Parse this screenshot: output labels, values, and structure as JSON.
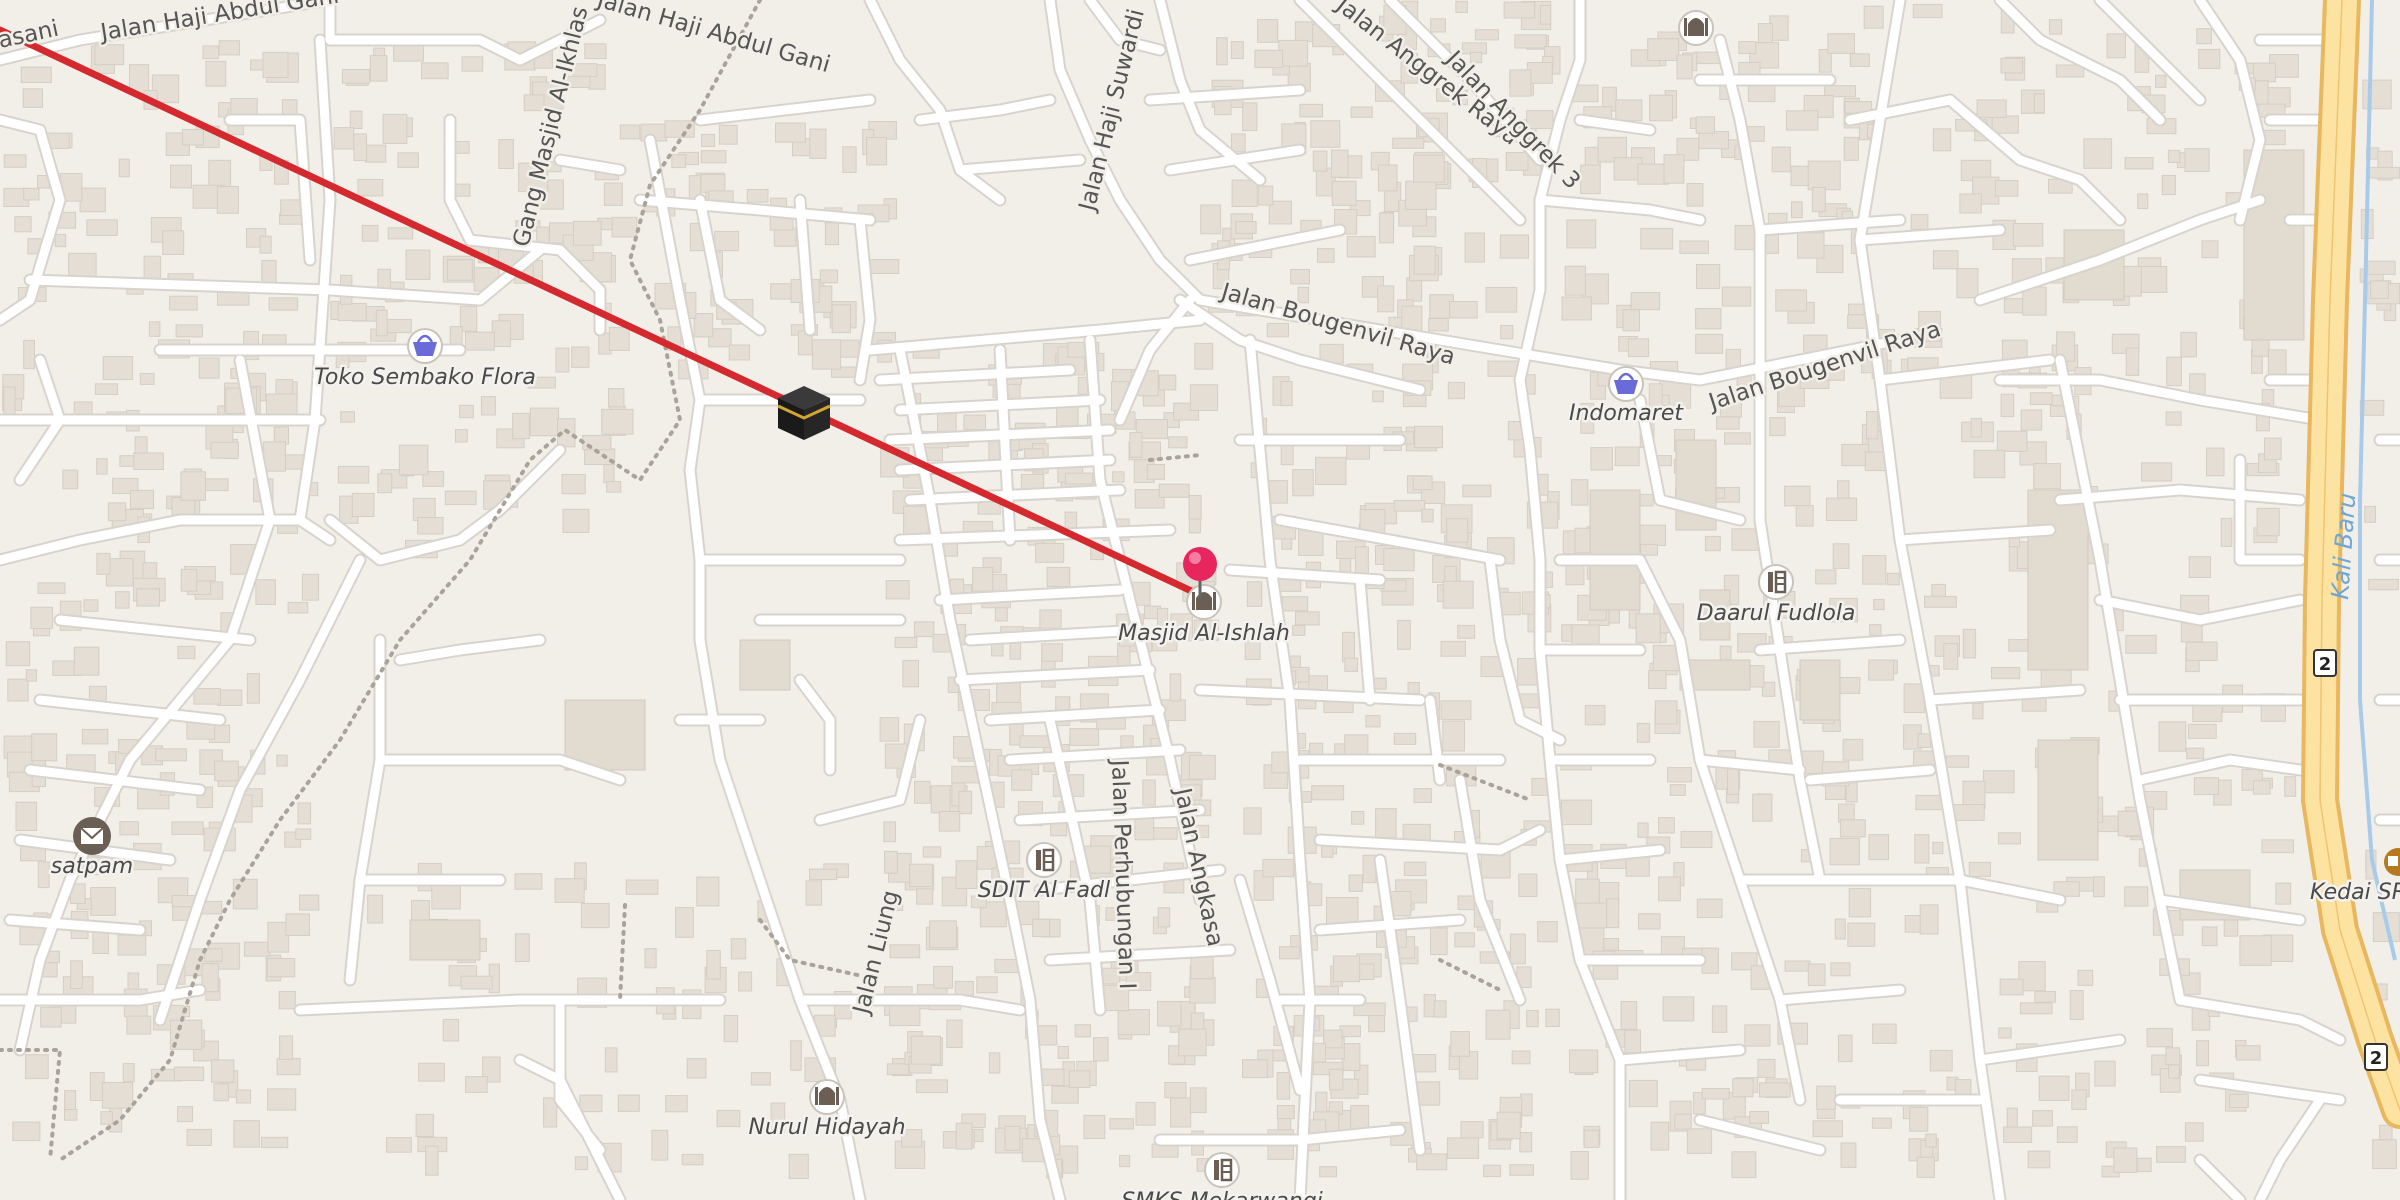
{
  "map": {
    "colors": {
      "background": "#f2efe9",
      "road": "#ffffff",
      "road_casing": "#d6d2cb",
      "building": "#e4ded4",
      "building_edge": "#d5cec3",
      "primary_road": "#fde3a1",
      "primary_casing": "#e8b75e",
      "qibla_line": "#d42a2f",
      "pin": "#e8265e",
      "water": "#a8cbea"
    },
    "streets": {
      "jalan_haji_abdul_gani_1": "Jalan Haji Abdul Gani",
      "jalan_haji_abdul_gani_2": "Jalan Haji Abdul Gani",
      "jalan_haji_abdul_gani_partial": "asani",
      "gang_masjid_al_ikhlas": "Gang Masjid Al-Ikhlas",
      "jalan_haji_suwardi": "Jalan Haji Suwardi",
      "jalan_anggrek_raya": "Jalan Anggrek Raya",
      "jalan_anggrek_3": "Jalan Anggrek 3",
      "jalan_bougenvil_raya_1": "Jalan Bougenvil Raya",
      "jalan_bougenvil_raya_2": "Jalan Bougenvil Raya",
      "jalan_perhubungan_i": "Jalan Perhubungan I",
      "jalan_angkasa": "Jalan Angkasa",
      "jalan_liung": "Jalan Liung",
      "kali_baru": "Kali Baru"
    },
    "pois": [
      {
        "id": "toko-sembako-flora",
        "label": "Toko Sembako Flora",
        "icon": "shopping-basket-icon"
      },
      {
        "id": "indomaret",
        "label": "Indomaret",
        "icon": "shopping-basket-icon"
      },
      {
        "id": "masjid-al-ishlah",
        "label": "Masjid Al-Ishlah",
        "icon": "mosque-icon"
      },
      {
        "id": "daarul-fudlola",
        "label": "Daarul Fudlola",
        "icon": "school-icon"
      },
      {
        "id": "sdit-al-fadl",
        "label": "SDIT Al Fadl",
        "icon": "school-icon"
      },
      {
        "id": "satpam",
        "label": "satpam",
        "icon": "post-office-icon"
      },
      {
        "id": "nurul-hidayah",
        "label": "Nurul Hidayah",
        "icon": "mosque-icon"
      },
      {
        "id": "smks-mekarwangi",
        "label": "SMKS Mekarwangi",
        "icon": "school-icon"
      },
      {
        "id": "kedai",
        "label": "Kedai SR",
        "icon": "cafe-icon"
      },
      {
        "id": "mosque-top",
        "label": "",
        "icon": "mosque-icon"
      }
    ],
    "route_shields": [
      "2",
      "2"
    ],
    "markers": {
      "qibla_line": "qibla-direction-line",
      "kaaba": "kaaba-icon",
      "location_pin": "location-pin-icon"
    }
  }
}
